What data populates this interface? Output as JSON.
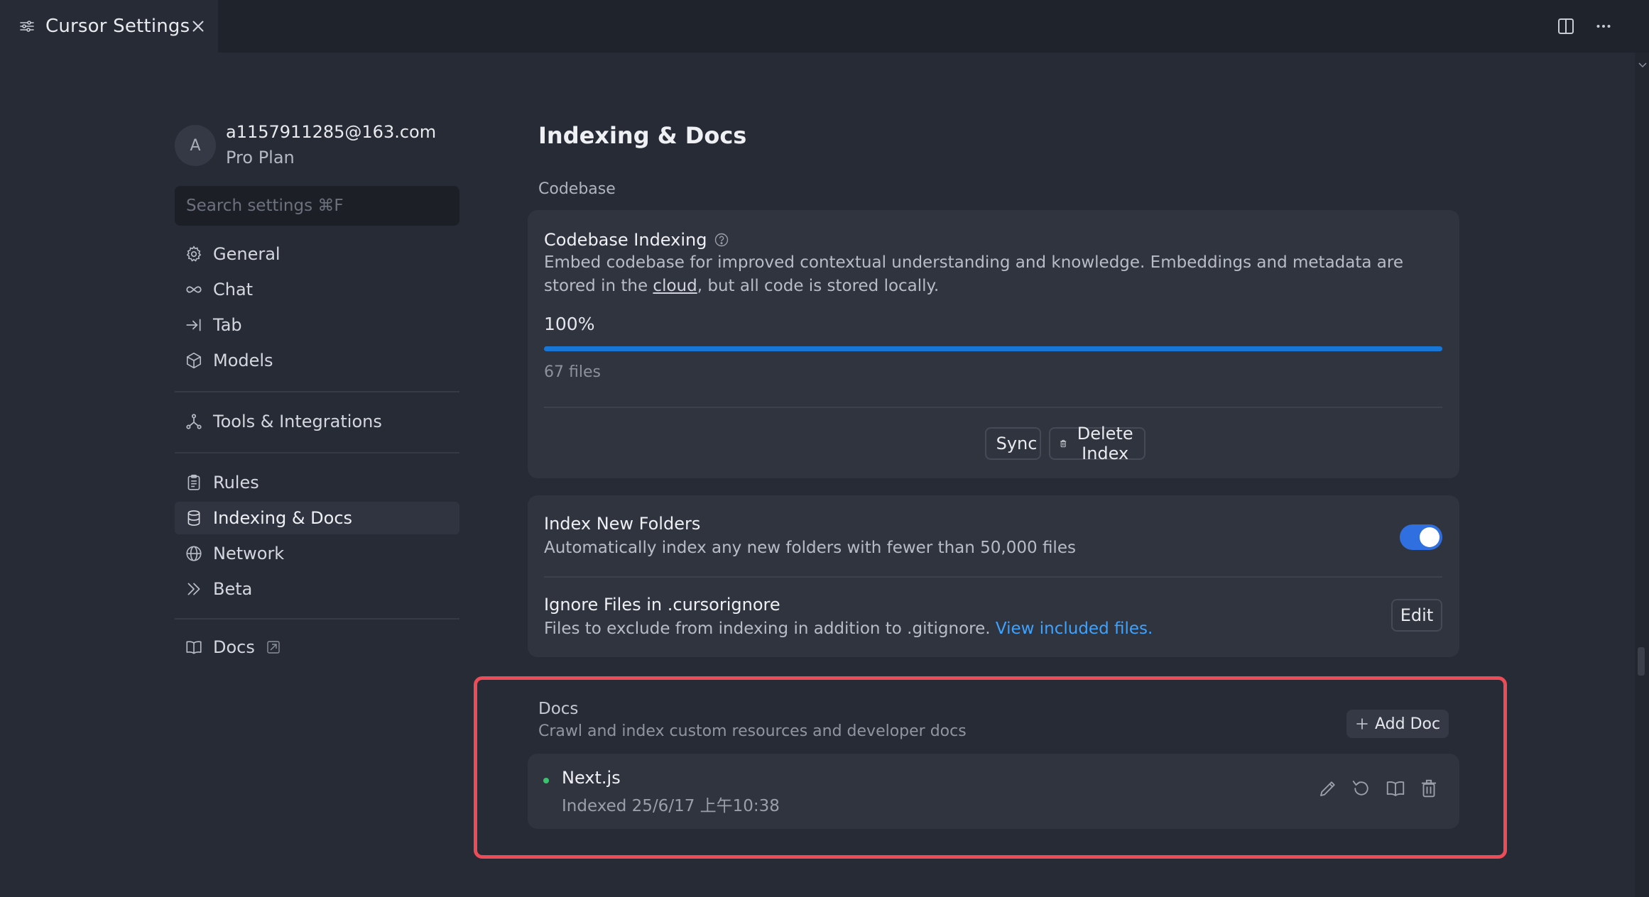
{
  "tab": {
    "title": "Cursor Settings"
  },
  "account": {
    "initial": "A",
    "email": "a1157911285@163.com",
    "plan": "Pro Plan"
  },
  "search": {
    "placeholder": "Search settings ⌘F"
  },
  "nav": {
    "general": "General",
    "chat": "Chat",
    "tab": "Tab",
    "models": "Models",
    "tools": "Tools & Integrations",
    "rules": "Rules",
    "indexing": "Indexing & Docs",
    "network": "Network",
    "beta": "Beta",
    "docs": "Docs",
    "active": "Indexing & Docs"
  },
  "main": {
    "title": "Indexing & Docs",
    "codebase_section": "Codebase",
    "codebase_indexing": {
      "title": "Codebase Indexing",
      "desc_before": "Embed codebase for improved contextual understanding and knowledge. Embeddings and metadata are stored in the ",
      "desc_link": "cloud",
      "desc_after": ", but all code is stored locally.",
      "progress_label": "100%",
      "progress_fraction": 1.0,
      "files": "67 files",
      "sync_label": "Sync",
      "delete_label": "Delete Index"
    },
    "index_new_folders": {
      "title": "Index New Folders",
      "desc": "Automatically index any new folders with fewer than 50,000 files",
      "enabled": true
    },
    "ignore_files": {
      "title": "Ignore Files in .cursorignore",
      "desc": "Files to exclude from indexing in addition to .gitignore. ",
      "link": "View included files.",
      "edit_label": "Edit"
    },
    "docs": {
      "title": "Docs",
      "subtitle": "Crawl and index custom resources and developer docs",
      "add_label": "Add Doc",
      "items": [
        {
          "name": "Next.js",
          "meta": "Indexed 25/6/17 上午10:38",
          "status_color": "#3ac46e"
        }
      ]
    }
  },
  "colors": {
    "accent": "#1877d6",
    "toggle": "#2f6fe0",
    "link": "#3ea3ff",
    "highlight": "#ec4c57"
  }
}
